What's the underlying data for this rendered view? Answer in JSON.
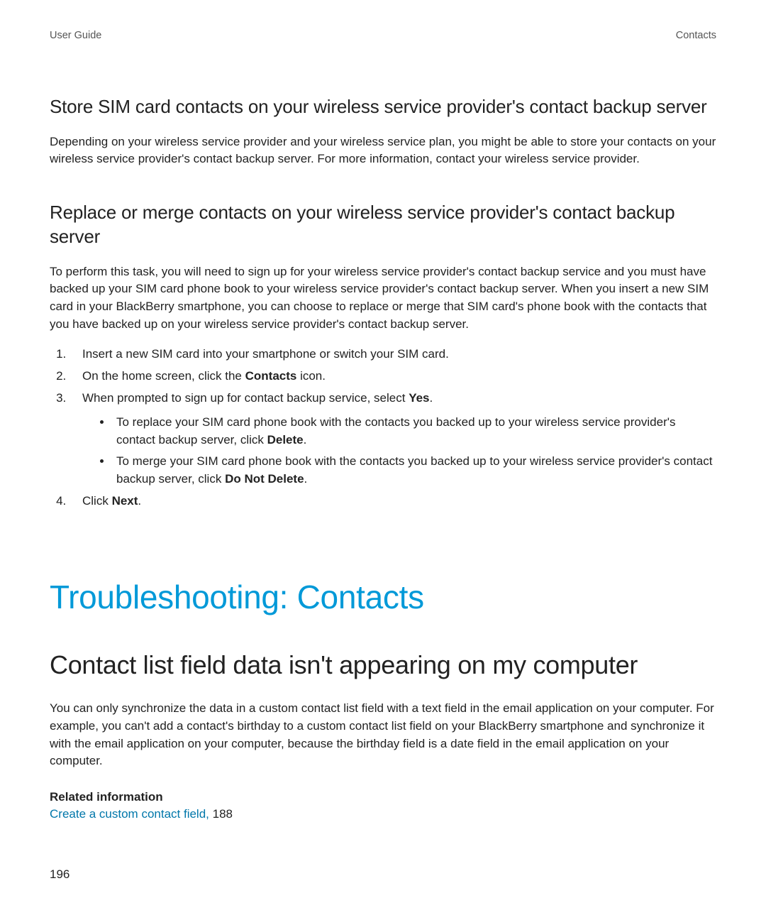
{
  "header": {
    "left": "User Guide",
    "right": "Contacts"
  },
  "section1": {
    "heading": "Store SIM card contacts on your wireless service provider's contact backup server",
    "body": "Depending on your wireless service provider and your wireless service plan, you might be able to store your contacts on your wireless service provider's contact backup server. For more information, contact your wireless service provider."
  },
  "section2": {
    "heading": "Replace or merge contacts on your wireless service provider's contact backup server",
    "intro": "To perform this task, you will need to sign up for your wireless service provider's contact backup service and you must have backed up your SIM card phone book to your wireless service provider's contact backup server. When you insert a new SIM card in your BlackBerry smartphone, you can choose to replace or merge that SIM card's phone book with the contacts that you have backed up on your wireless service provider's contact backup server.",
    "steps": {
      "s1": "Insert a new SIM card into your smartphone or switch your SIM card.",
      "s2_pre": "On the home screen, click the ",
      "s2_bold": "Contacts",
      "s2_post": " icon.",
      "s3_pre": "When prompted to sign up for contact backup service, select ",
      "s3_bold": "Yes",
      "s3_post": ".",
      "s3_b1_pre": "To replace your SIM card phone book with the contacts you backed up to your wireless service provider's contact backup server, click ",
      "s3_b1_bold": "Delete",
      "s3_b1_post": ".",
      "s3_b2_pre": "To merge your SIM card phone book with the contacts you backed up to your wireless service provider's contact backup server, click ",
      "s3_b2_bold": "Do Not Delete",
      "s3_b2_post": ".",
      "s4_pre": "Click ",
      "s4_bold": "Next",
      "s4_post": "."
    }
  },
  "chapter": {
    "title": "Troubleshooting: Contacts"
  },
  "topic": {
    "title": "Contact list field data isn't appearing on my computer",
    "body": "You can only synchronize the data in a custom contact list field with a text field in the email application on your computer. For example, you can't add a contact's birthday to a custom contact list field on your BlackBerry smartphone and synchronize it with the email application on your computer, because the birthday field is a date field in the email application on your computer."
  },
  "related": {
    "heading": "Related information",
    "link_text": "Create a custom contact field,",
    "link_page": " 188"
  },
  "page_number": "196"
}
